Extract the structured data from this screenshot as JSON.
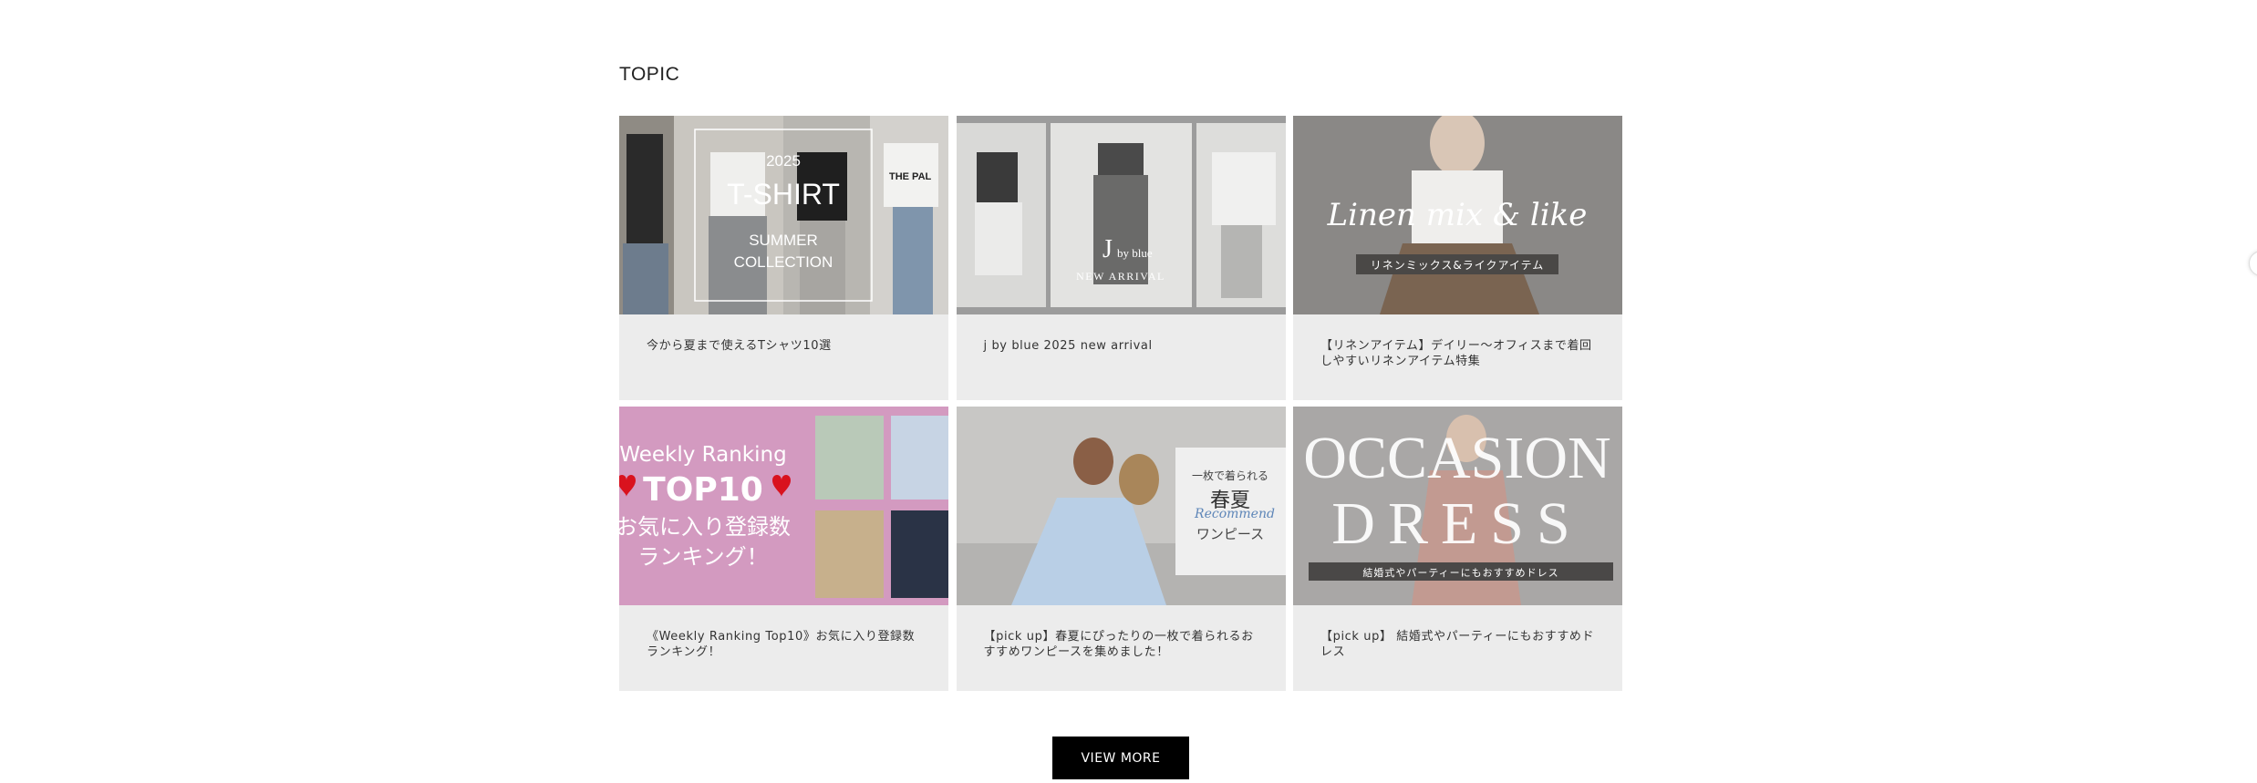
{
  "topic": {
    "title": "TOPIC",
    "cards": [
      {
        "caption": "今から夏まで使えるTシャツ10選",
        "image": {
          "line1": "2025",
          "line2": "T-SHIRT",
          "line3": "SUMMER",
          "line4": "COLLECTION",
          "side_text": "THE PAL"
        }
      },
      {
        "caption": "j by blue 2025 new arrival",
        "image": {
          "logo_letter": "J",
          "logo_text": "by blue",
          "subtitle": "NEW ARRIVAL"
        }
      },
      {
        "caption": "【リネンアイテム】デイリー〜オフィスまで着回しやすいリネンアイテム特集",
        "image": {
          "script": "Linen mix & like",
          "band": "リネンミックス&ライクアイテム"
        }
      },
      {
        "caption": "《Weekly Ranking Top10》お気に入り登録数ランキング！",
        "image": {
          "line1": "Weekly Ranking",
          "line2": "TOP10",
          "line3": "お気に入り登録数",
          "line4": "ランキング！"
        }
      },
      {
        "caption": "【pick up】春夏にぴったりの一枚で着られるおすすめワンピースを集めました！",
        "image": {
          "small": "一枚で着られる",
          "big": "春夏",
          "script": "Recommend",
          "bottom": "ワンピース"
        }
      },
      {
        "caption": "【pick up】 結婚式やパーティーにもおすすめドレス",
        "image": {
          "line1": "OCCASION",
          "line2": "DRESS",
          "band": "結婚式やパーティーにもおすすめドレス"
        }
      }
    ],
    "view_more_label": "VIEW MORE"
  },
  "colors": {
    "background": "#ffffff",
    "card_bg": "#ececec",
    "button_bg": "#000000",
    "button_text": "#ffffff",
    "ranking_pink": "#d39ac0",
    "heart_red": "#d9121e"
  },
  "icons": {
    "edge_arrow": "carousel-next-icon"
  }
}
